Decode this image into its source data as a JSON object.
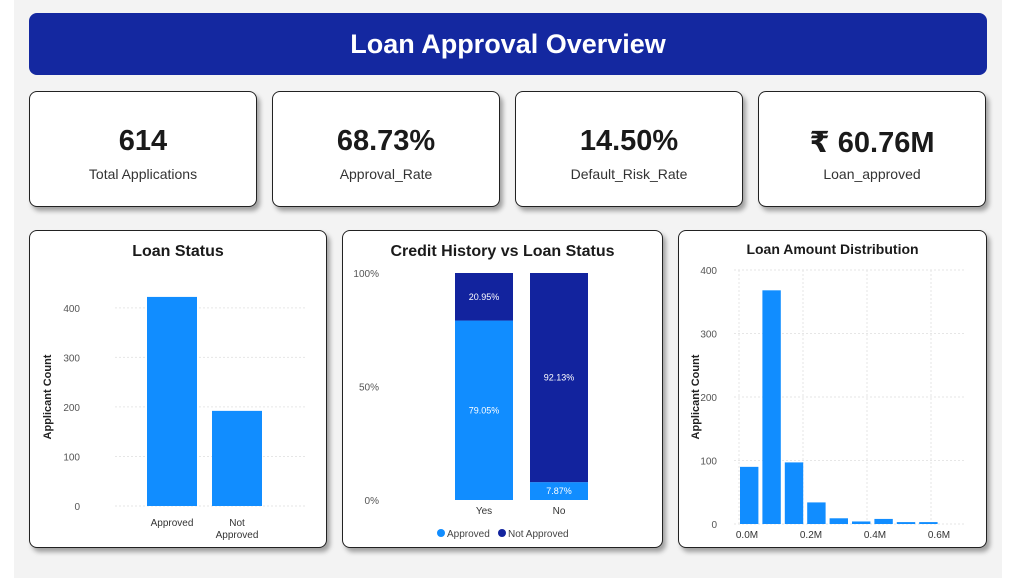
{
  "header": {
    "title": "Loan Approval Overview"
  },
  "kpis": [
    {
      "value": "614",
      "label": "Total Applications"
    },
    {
      "value": "68.73%",
      "label": "Approval_Rate"
    },
    {
      "value": "14.50%",
      "label": "Default_Risk_Rate"
    },
    {
      "value": "₹ 60.76M",
      "label": "Loan_approved"
    }
  ],
  "colors": {
    "header": "#1428a0",
    "light_blue": "#118dff",
    "dark_blue": "#12239e"
  },
  "chart_data": [
    {
      "type": "bar",
      "title": "Loan Status",
      "ylabel": "Applicant Count",
      "xlabel": "",
      "categories": [
        "Approved",
        "Not Approved"
      ],
      "values": [
        422,
        192
      ],
      "ylim": [
        0,
        440
      ],
      "yticks": [
        "0",
        "100",
        "200",
        "300",
        "400"
      ],
      "grid": true
    },
    {
      "type": "bar",
      "stacked": "100%",
      "title": "Credit History vs Loan Status",
      "categories": [
        "Yes",
        "No"
      ],
      "yticks": [
        "0%",
        "50%",
        "100%"
      ],
      "series": [
        {
          "name": "Approved",
          "values": [
            79.05,
            7.87
          ],
          "labels": [
            "79.05%",
            "7.87%"
          ]
        },
        {
          "name": "Not Approved",
          "values": [
            20.95,
            92.13
          ],
          "labels": [
            "20.95%",
            "92.13%"
          ]
        }
      ],
      "legend": "bottom"
    },
    {
      "type": "bar",
      "title": "Loan Amount Distribution",
      "ylabel": "Applicant Count",
      "xlabel": "",
      "bins_start": 0.0,
      "bin_width": 0.07,
      "values": [
        90,
        368,
        97,
        34,
        9,
        4,
        8,
        3,
        3
      ],
      "ylim": [
        0,
        400
      ],
      "xticks": [
        "0.0M",
        "0.2M",
        "0.4M",
        "0.6M"
      ],
      "xtick_values": [
        0.0,
        0.2,
        0.4,
        0.6
      ],
      "yticks": [
        "0",
        "100",
        "200",
        "300",
        "400"
      ],
      "grid": true
    }
  ]
}
